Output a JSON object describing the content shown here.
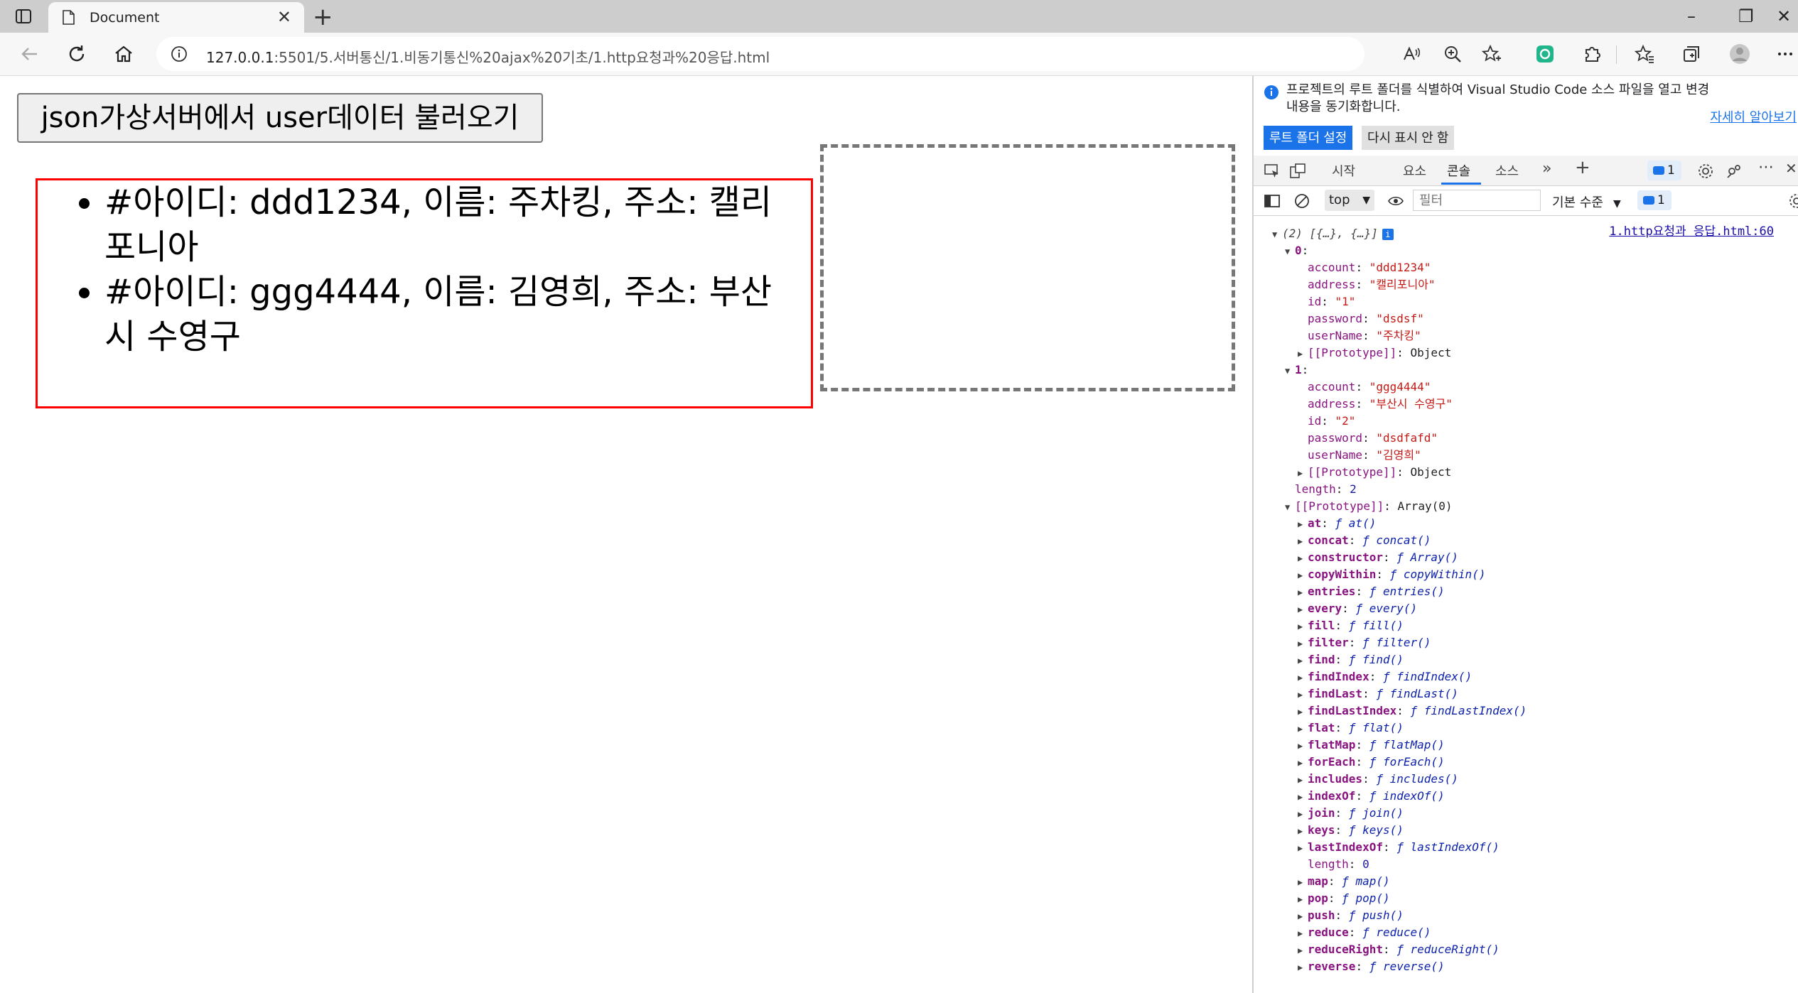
{
  "browser": {
    "tab_title": "Document",
    "url_host": "127.0.0.1",
    "url_rest": ":5501/5.서버통신/1.비동기통신%20ajax%20기초/1.http요청과%20응답.html"
  },
  "page": {
    "load_button_label": "json가상서버에서 user데이터 불러오기",
    "users": [
      "#아이디: ddd1234, 이름: 주차킹, 주소: 캘리포니아",
      "#아이디: ggg4444, 이름: 김영희, 주소: 부산시 수영구"
    ]
  },
  "devtools": {
    "banner": {
      "text": "프로젝트의 루트 폴더를 식별하여 Visual Studio Code 소스 파일을 열고 변경 내용을 동기화합니다.",
      "learn_more": "자세히 알아보기",
      "set_root": "루트 폴더 설정",
      "dont_show": "다시 표시 안 함"
    },
    "tabs": {
      "start": "시작",
      "elements": "요소",
      "console": "콘솔",
      "sources": "소스",
      "badge": "1"
    },
    "console_toolbar": {
      "context": "top",
      "filter_placeholder": "필터",
      "levels": "기본 수준",
      "badge": "1"
    },
    "source_link": "1.http요청과 응답.html:60",
    "header": "(2) [{…}, {…}]",
    "objects": [
      {
        "index": "0",
        "props": [
          {
            "key": "account",
            "value": "\"ddd1234\""
          },
          {
            "key": "address",
            "value": "\"캘리포니아\""
          },
          {
            "key": "id",
            "value": "\"1\""
          },
          {
            "key": "password",
            "value": "\"dsdsf\""
          },
          {
            "key": "userName",
            "value": "\"주차킹\""
          }
        ],
        "proto": "[[Prototype]]",
        "proto_val": "Object"
      },
      {
        "index": "1",
        "props": [
          {
            "key": "account",
            "value": "\"ggg4444\""
          },
          {
            "key": "address",
            "value": "\"부산시 수영구\""
          },
          {
            "key": "id",
            "value": "\"2\""
          },
          {
            "key": "password",
            "value": "\"dsdfafd\""
          },
          {
            "key": "userName",
            "value": "\"김영희\""
          }
        ],
        "proto": "[[Prototype]]",
        "proto_val": "Object"
      }
    ],
    "length_key": "length",
    "length_val": "2",
    "array_proto_key": "[[Prototype]]",
    "array_proto_val": "Array(0)",
    "methods": [
      {
        "key": "at",
        "fn": "at()"
      },
      {
        "key": "concat",
        "fn": "concat()"
      },
      {
        "key": "constructor",
        "fn": "Array()"
      },
      {
        "key": "copyWithin",
        "fn": "copyWithin()"
      },
      {
        "key": "entries",
        "fn": "entries()"
      },
      {
        "key": "every",
        "fn": "every()"
      },
      {
        "key": "fill",
        "fn": "fill()"
      },
      {
        "key": "filter",
        "fn": "filter()"
      },
      {
        "key": "find",
        "fn": "find()"
      },
      {
        "key": "findIndex",
        "fn": "findIndex()"
      },
      {
        "key": "findLast",
        "fn": "findLast()"
      },
      {
        "key": "findLastIndex",
        "fn": "findLastIndex()"
      },
      {
        "key": "flat",
        "fn": "flat()"
      },
      {
        "key": "flatMap",
        "fn": "flatMap()"
      },
      {
        "key": "forEach",
        "fn": "forEach()"
      },
      {
        "key": "includes",
        "fn": "includes()"
      },
      {
        "key": "indexOf",
        "fn": "indexOf()"
      },
      {
        "key": "join",
        "fn": "join()"
      },
      {
        "key": "keys",
        "fn": "keys()"
      },
      {
        "key": "lastIndexOf",
        "fn": "lastIndexOf()"
      },
      {
        "key": "length",
        "plain": "0"
      },
      {
        "key": "map",
        "fn": "map()"
      },
      {
        "key": "pop",
        "fn": "pop()"
      },
      {
        "key": "push",
        "fn": "push()"
      },
      {
        "key": "reduce",
        "fn": "reduce()"
      },
      {
        "key": "reduceRight",
        "fn": "reduceRight()"
      },
      {
        "key": "reverse",
        "fn": "reverse()"
      }
    ]
  },
  "colors": {
    "accent": "#1a73e8",
    "list_border": "#ff0000",
    "dashed_border": "#777777"
  }
}
